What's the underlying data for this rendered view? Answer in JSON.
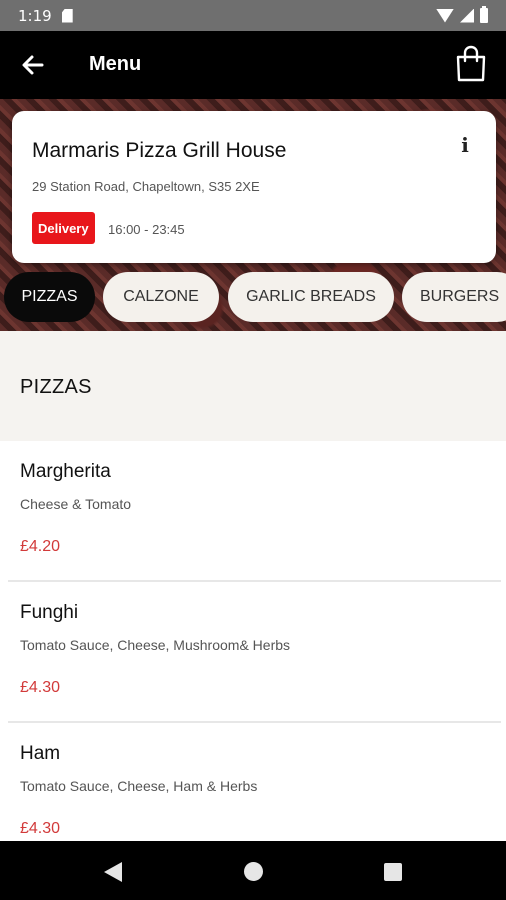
{
  "status_bar": {
    "time": "1:19"
  },
  "app_bar": {
    "title": "Menu",
    "back_icon": "arrow-left-icon",
    "cart_icon": "shopping-bag-icon"
  },
  "restaurant": {
    "name": "Marmaris Pizza Grill House",
    "address": "29 Station Road, Chapeltown, S35 2XE",
    "badge": "Delivery",
    "hours": "16:00 - 23:45",
    "info_icon": "info-icon"
  },
  "categories": [
    {
      "label": "PIZZAS",
      "active": true
    },
    {
      "label": "CALZONE",
      "active": false
    },
    {
      "label": "GARLIC BREADS",
      "active": false
    },
    {
      "label": "BURGERS",
      "active": false
    }
  ],
  "section": {
    "title": "PIZZAS"
  },
  "items": [
    {
      "name": "Margherita",
      "description": "Cheese & Tomato",
      "price": "£4.20"
    },
    {
      "name": "Funghi",
      "description": "Tomato Sauce, Cheese, Mushroom& Herbs",
      "price": "£4.30"
    },
    {
      "name": "Ham",
      "description": "Tomato Sauce, Cheese, Ham & Herbs",
      "price": "£4.30"
    }
  ],
  "colors": {
    "accent": "#e8161b",
    "price": "#d23a3a",
    "app_bar": "#000000",
    "section_bg": "#f5f3f0"
  },
  "nav_bar": {
    "back_icon": "nav-back-icon",
    "home_icon": "nav-home-icon",
    "recents_icon": "nav-recents-icon"
  }
}
